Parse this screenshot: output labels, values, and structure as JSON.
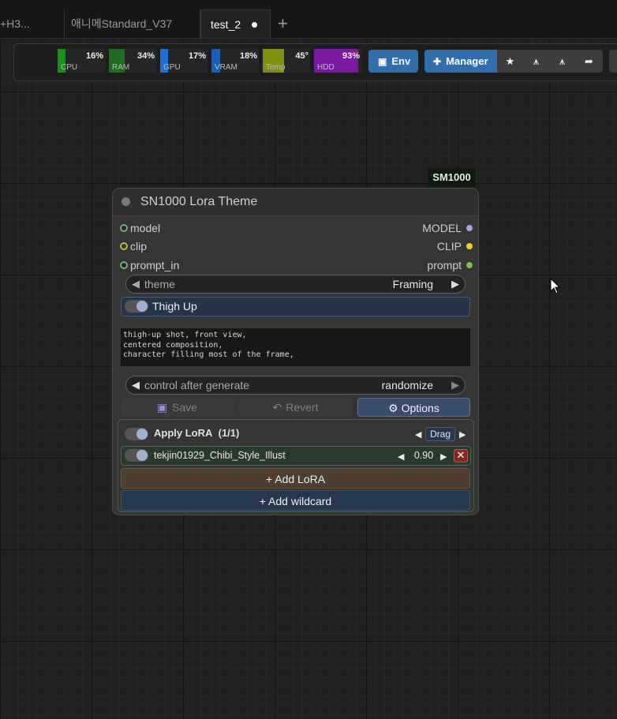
{
  "tabs": [
    {
      "label": "+H3..."
    },
    {
      "label": "애니메Standard_V37"
    },
    {
      "label": "test_2",
      "active": true,
      "unsaved": true
    }
  ],
  "monitors": [
    {
      "label": "CPU",
      "percent": "16%",
      "value": 16,
      "color": "#1a8f1a"
    },
    {
      "label": "RAM",
      "percent": "34%",
      "value": 34,
      "color": "#1f6b1f"
    },
    {
      "label": "GPU",
      "percent": "17%",
      "value": 17,
      "color": "#1b6fd6"
    },
    {
      "label": "VRAM",
      "percent": "18%",
      "value": 18,
      "color": "#1b5fb5"
    },
    {
      "label": "Temp",
      "percent": "45°",
      "value": 45,
      "color": "#7f8f10"
    },
    {
      "label": "HDD",
      "percent": "93%",
      "value": 93,
      "color": "#7a1aa3"
    }
  ],
  "toolbar": {
    "env_label": "Env",
    "manager_label": "Manager",
    "icon_buttons": [
      "star-icon",
      "share-person-icon",
      "share-person-alt-icon",
      "share-arrow-icon"
    ]
  },
  "badge": "SM1000",
  "node": {
    "title": "SN1000 Lora Theme",
    "inputs": [
      {
        "name": "model",
        "color": "#7ea87e"
      },
      {
        "name": "clip",
        "color": "#b8b84a"
      },
      {
        "name": "prompt_in",
        "color": "#7ea87e"
      }
    ],
    "outputs": [
      {
        "name": "MODEL",
        "color": "#b39ddb"
      },
      {
        "name": "CLIP",
        "color": "#f2d21b"
      },
      {
        "name": "prompt",
        "color": "#7bc242"
      }
    ],
    "theme_widget": {
      "name": "theme",
      "value": "Framing"
    },
    "toggle_label": "Thigh Up",
    "prompt_text": "thigh-up shot, front view,\ncentered composition,\ncharacter filling most of the frame,",
    "control_widget": {
      "name": "control after generate",
      "value": "randomize"
    },
    "buttons": {
      "save": "Save",
      "revert": "Revert",
      "options": "⚙ Options"
    },
    "lora_header": {
      "label": "Apply LoRA",
      "count": "(1/1)",
      "drag": "Drag"
    },
    "lora": {
      "name": "tekjin01929_Chibi_Style_Illust",
      "strength": "0.90"
    },
    "add_lora": "+ Add LoRA",
    "add_wildcard": "+ Add wildcard"
  }
}
